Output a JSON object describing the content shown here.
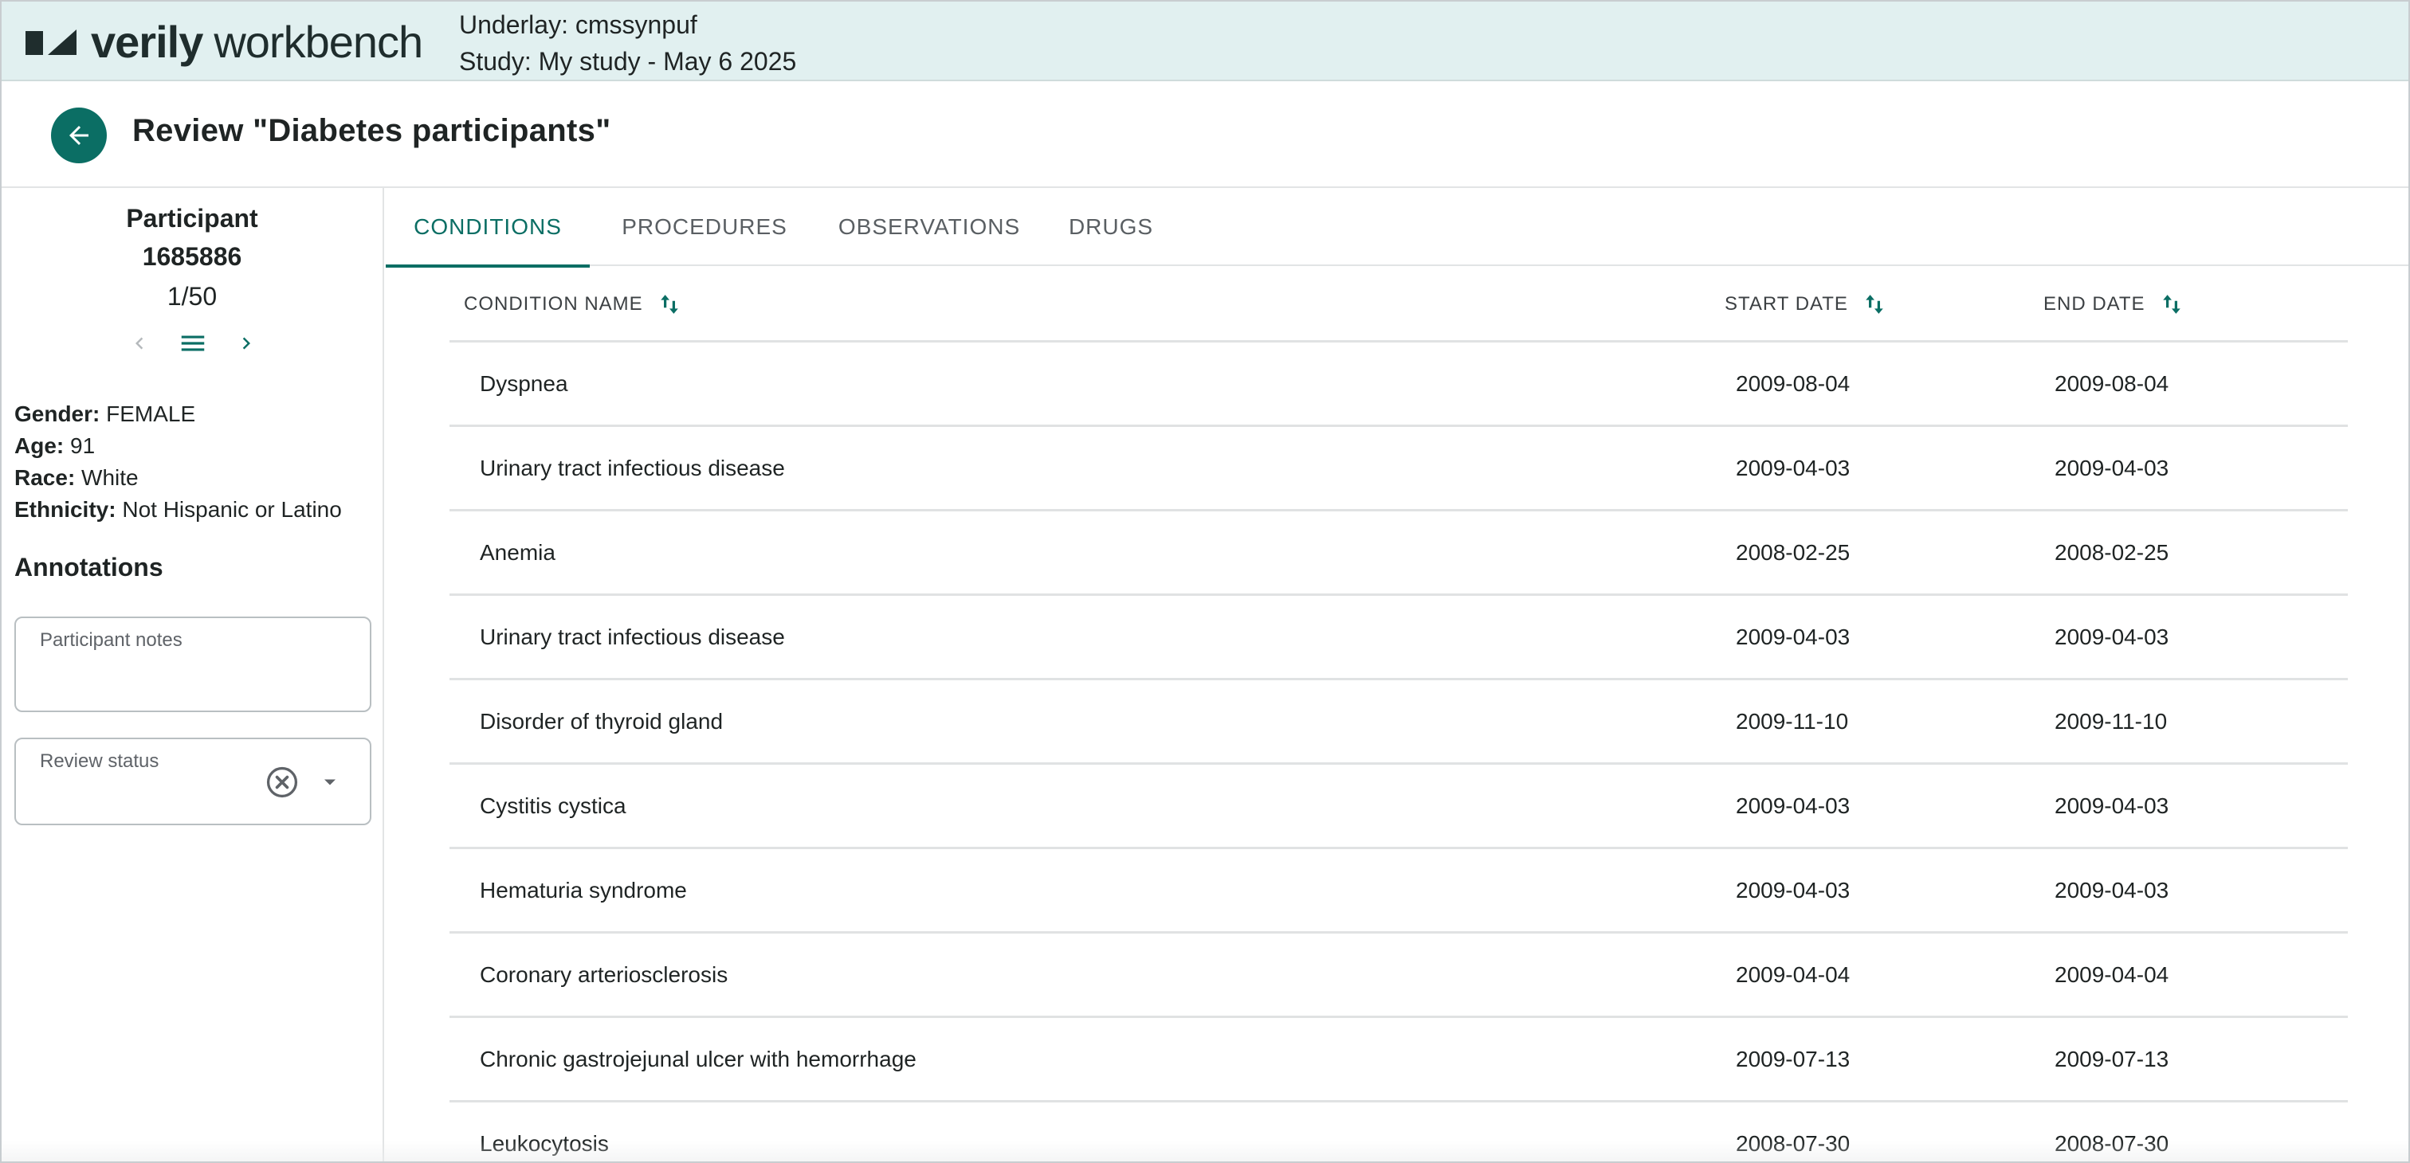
{
  "banner": {
    "brand_bold": "verily",
    "brand_light": "workbench",
    "underlay": "Underlay: cmssynpuf",
    "study": "Study: My study - May 6 2025",
    "brand_color": "#0b6e64"
  },
  "header": {
    "title": "Review \"Diabetes participants\"",
    "back_icon": "arrow-left-icon"
  },
  "participant": {
    "label": "Participant",
    "id": "1685886",
    "position": "1/50",
    "demographics": [
      {
        "key": "Gender:",
        "value": "FEMALE"
      },
      {
        "key": "Age:",
        "value": "91"
      },
      {
        "key": "Race:",
        "value": "White"
      },
      {
        "key": "Ethnicity:",
        "value": "Not Hispanic or Latino"
      }
    ]
  },
  "annotations": {
    "title": "Annotations",
    "notes_label": "Participant notes",
    "notes_value": "",
    "status_label": "Review status",
    "status_value": ""
  },
  "tabs": [
    {
      "label": "CONDITIONS",
      "active": true
    },
    {
      "label": "PROCEDURES",
      "active": false
    },
    {
      "label": "OBSERVATIONS",
      "active": false
    },
    {
      "label": "DRUGS",
      "active": false
    }
  ],
  "table": {
    "columns": [
      "CONDITION NAME",
      "START DATE",
      "END DATE"
    ],
    "rows": [
      {
        "name": "Dyspnea",
        "start": "2009-08-04",
        "end": "2009-08-04"
      },
      {
        "name": "Urinary tract infectious disease",
        "start": "2009-04-03",
        "end": "2009-04-03"
      },
      {
        "name": "Anemia",
        "start": "2008-02-25",
        "end": "2008-02-25"
      },
      {
        "name": "Urinary tract infectious disease",
        "start": "2009-04-03",
        "end": "2009-04-03"
      },
      {
        "name": "Disorder of thyroid gland",
        "start": "2009-11-10",
        "end": "2009-11-10"
      },
      {
        "name": "Cystitis cystica",
        "start": "2009-04-03",
        "end": "2009-04-03"
      },
      {
        "name": "Hematuria syndrome",
        "start": "2009-04-03",
        "end": "2009-04-03"
      },
      {
        "name": "Coronary arteriosclerosis",
        "start": "2009-04-04",
        "end": "2009-04-04"
      },
      {
        "name": "Chronic gastrojejunal ulcer with hemorrhage",
        "start": "2009-07-13",
        "end": "2009-07-13"
      },
      {
        "name": "Leukocytosis",
        "start": "2008-07-30",
        "end": "2008-07-30"
      }
    ]
  }
}
